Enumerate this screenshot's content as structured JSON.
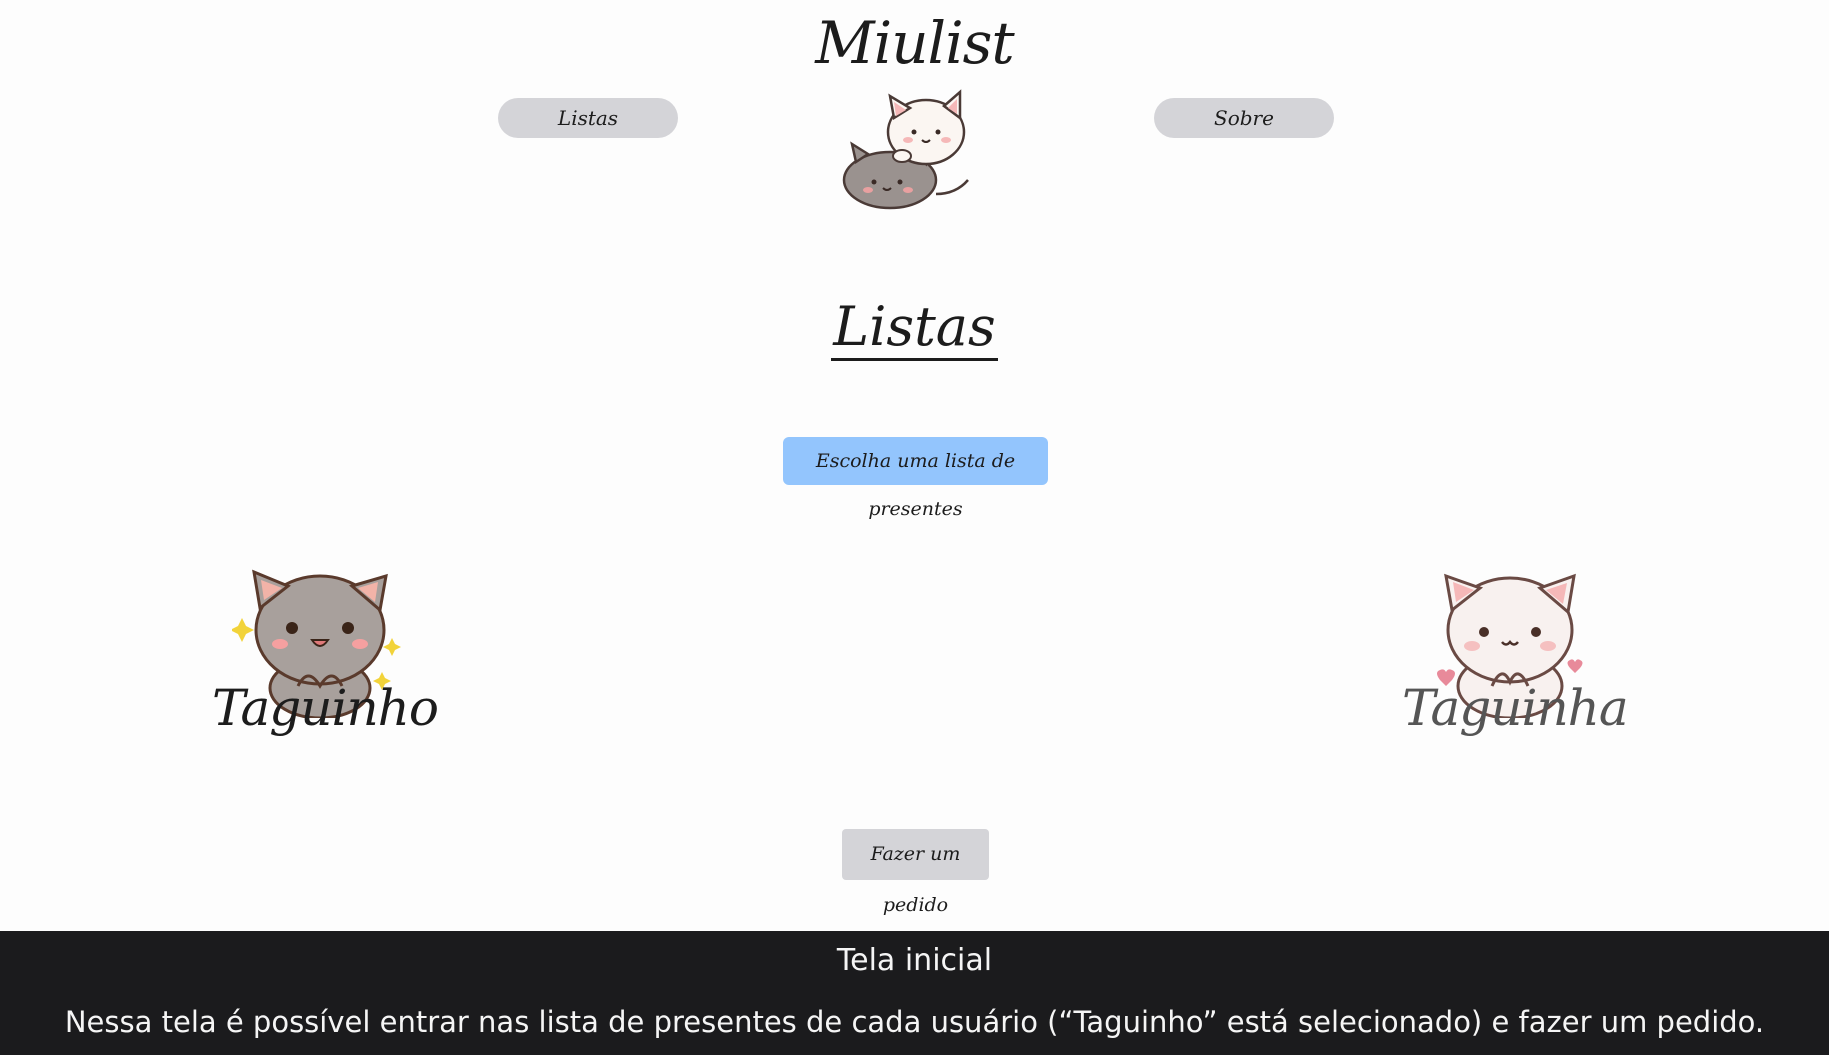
{
  "header": {
    "brand": "Miulist",
    "nav": {
      "listas_label": "Listas",
      "sobre_label": "Sobre"
    }
  },
  "main": {
    "title": "Listas",
    "choose_label": "Escolha uma lista de presentes",
    "users": [
      {
        "name": "Taguinho",
        "selected": true
      },
      {
        "name": "Taguinha",
        "selected": false
      }
    ],
    "order_label": "Fazer um pedido"
  },
  "caption": {
    "title": "Tela inicial",
    "text": "Nessa tela é possível entrar nas lista de presentes de cada usuário (“Taguinho” está selecionado) e fazer um pedido."
  },
  "colors": {
    "nav_button": "#d4d4d8",
    "choose_button": "#93c5fd",
    "caption_bar": "#1b1b1d"
  },
  "icons": {
    "logo": "two-cats-logo",
    "taguinho": "grey-cat-sticker",
    "taguinha": "white-cat-sticker"
  }
}
